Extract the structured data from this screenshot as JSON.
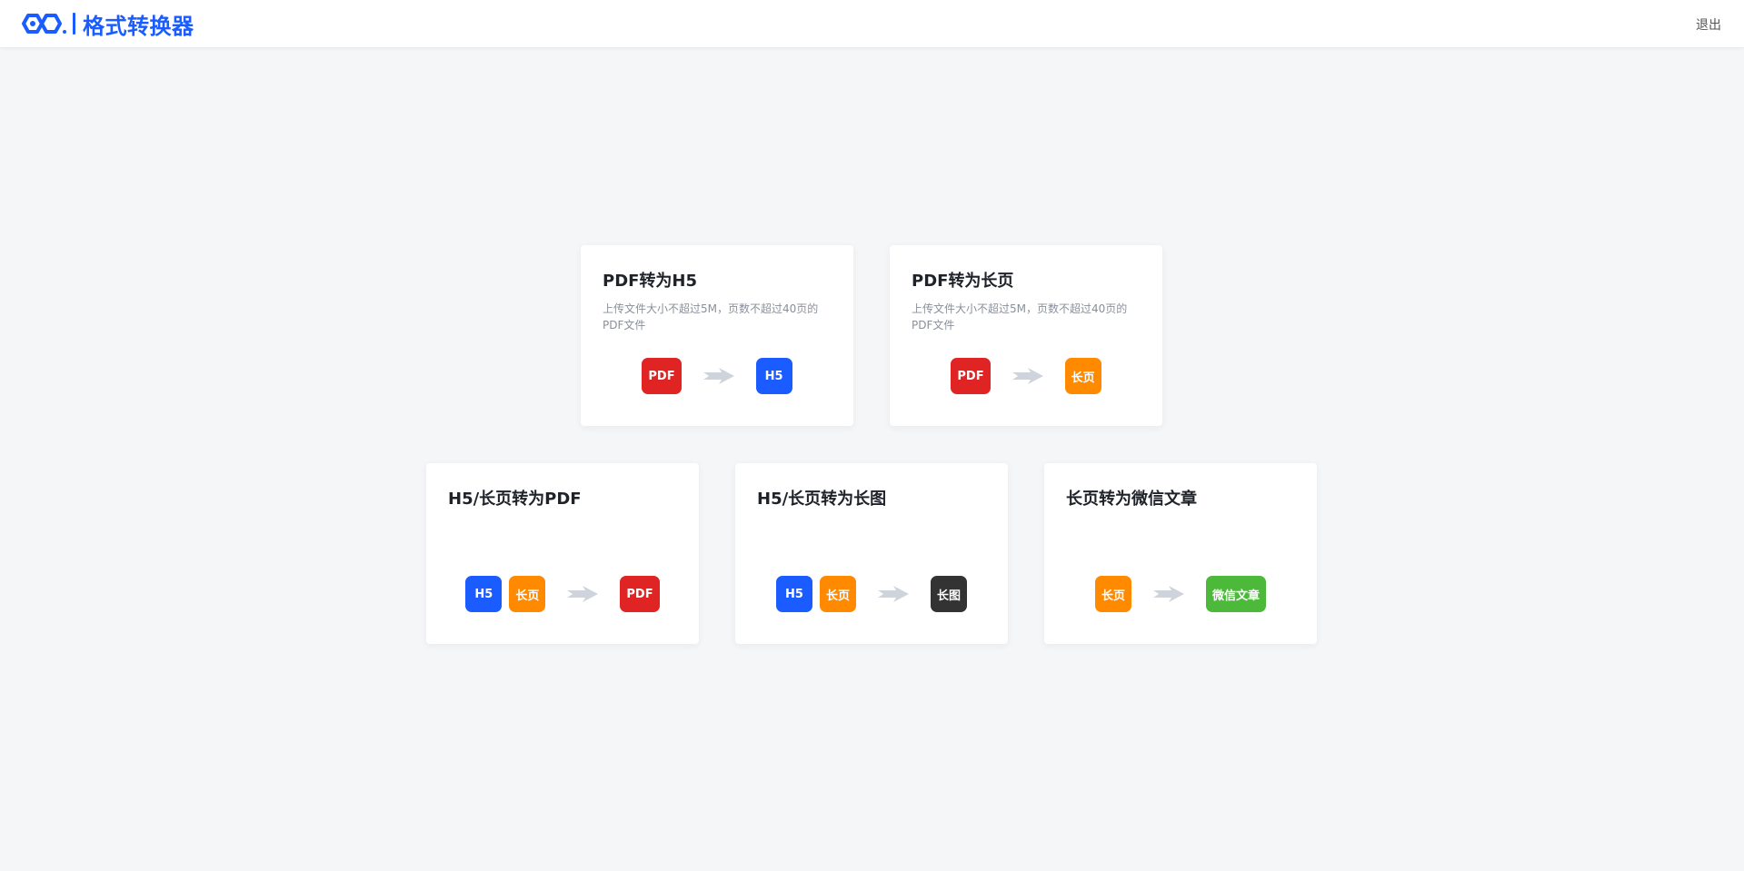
{
  "header": {
    "app_title": "格式转换器",
    "logout_label": "退出",
    "logo_icon": "link-chain-icon",
    "brand_color": "#1a5cff"
  },
  "colors": {
    "pdf": "#e02424",
    "h5": "#1a5cff",
    "changye": "#ff8a00",
    "changtu": "#333333",
    "weixin": "#4cb93a",
    "arrow": "#cfd4dc"
  },
  "cards": [
    {
      "title": "PDF转为H5",
      "desc": "上传文件大小不超过5M，页数不超过40页的PDF文件",
      "from": [
        {
          "label": "PDF",
          "color": "#e02424"
        }
      ],
      "to": [
        {
          "label": "H5",
          "color": "#1a5cff"
        }
      ]
    },
    {
      "title": "PDF转为长页",
      "desc": "上传文件大小不超过5M，页数不超过40页的PDF文件",
      "from": [
        {
          "label": "PDF",
          "color": "#e02424"
        }
      ],
      "to": [
        {
          "label": "长页",
          "color": "#ff8a00"
        }
      ]
    },
    {
      "title": "H5/长页转为PDF",
      "desc": "",
      "from": [
        {
          "label": "H5",
          "color": "#1a5cff"
        },
        {
          "label": "长页",
          "color": "#ff8a00"
        }
      ],
      "to": [
        {
          "label": "PDF",
          "color": "#e02424"
        }
      ]
    },
    {
      "title": "H5/长页转为长图",
      "desc": "",
      "from": [
        {
          "label": "H5",
          "color": "#1a5cff"
        },
        {
          "label": "长页",
          "color": "#ff8a00"
        }
      ],
      "to": [
        {
          "label": "长图",
          "color": "#333333"
        }
      ]
    },
    {
      "title": "长页转为微信文章",
      "desc": "",
      "from": [
        {
          "label": "长页",
          "color": "#ff8a00"
        }
      ],
      "to": [
        {
          "label": "微信文章",
          "color": "#4cb93a"
        }
      ]
    }
  ]
}
